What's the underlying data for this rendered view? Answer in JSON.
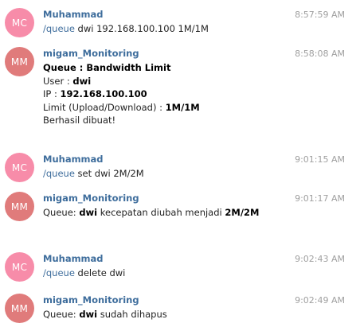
{
  "colors": {
    "mc_avatar": "#f78ca9",
    "mm_avatar": "#e07b7b",
    "name": "#3e6d9c",
    "time": "#a0a0a0"
  },
  "messages": [
    {
      "avatar": "MC",
      "sender": "Muhammad",
      "time": "8:57:59 AM",
      "lines": [
        [
          {
            "t": "/queue",
            "cmd": true
          },
          {
            "t": " dwi 192.168.100.100 1M/1M"
          }
        ]
      ]
    },
    {
      "avatar": "MM",
      "sender": "migam_Monitoring",
      "time": "8:58:08 AM",
      "lines": [
        [
          {
            "t": "Queue : Bandwidth Limit",
            "b": true
          }
        ],
        [
          {
            "t": "User : "
          },
          {
            "t": "dwi",
            "b": true
          }
        ],
        [
          {
            "t": "IP : "
          },
          {
            "t": "192.168.100.100",
            "b": true
          }
        ],
        [
          {
            "t": "Limit (Upload/Download) : "
          },
          {
            "t": "1M/1M",
            "b": true
          }
        ],
        [
          {
            "t": "Berhasil dibuat!"
          }
        ]
      ]
    },
    {
      "avatar": "MC",
      "sender": "Muhammad",
      "time": "9:01:15 AM",
      "lines": [
        [
          {
            "t": "/queue",
            "cmd": true
          },
          {
            "t": " set dwi 2M/2M"
          }
        ]
      ]
    },
    {
      "avatar": "MM",
      "sender": "migam_Monitoring",
      "time": "9:01:17 AM",
      "lines": [
        [
          {
            "t": "Queue: "
          },
          {
            "t": "dwi",
            "b": true
          },
          {
            "t": " kecepatan diubah menjadi "
          },
          {
            "t": "2M/2M",
            "b": true
          }
        ]
      ]
    },
    {
      "avatar": "MC",
      "sender": "Muhammad",
      "time": "9:02:43 AM",
      "lines": [
        [
          {
            "t": "/queue",
            "cmd": true
          },
          {
            "t": " delete dwi"
          }
        ]
      ]
    },
    {
      "avatar": "MM",
      "sender": "migam_Monitoring",
      "time": "9:02:49 AM",
      "lines": [
        [
          {
            "t": "Queue: "
          },
          {
            "t": "dwi",
            "b": true
          },
          {
            "t": " sudah dihapus"
          }
        ]
      ]
    }
  ]
}
